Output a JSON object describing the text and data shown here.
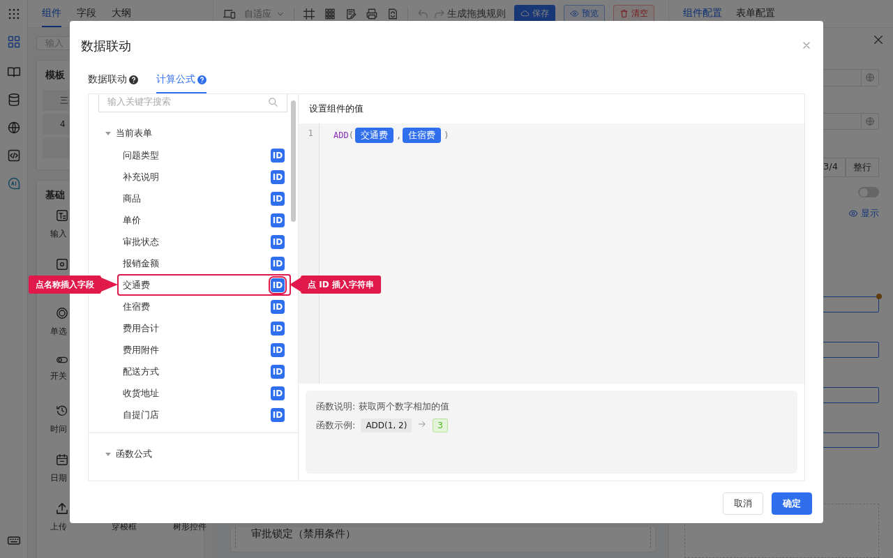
{
  "app": {
    "header_tabs": [
      {
        "label": "组件",
        "selected": true
      },
      {
        "label": "字段",
        "selected": false
      },
      {
        "label": "大纲",
        "selected": false
      }
    ],
    "toolbar": {
      "layout_select": "自适应",
      "generate": "生成拖拽规则",
      "buttons": [
        {
          "label": "保存",
          "kind": "primary"
        },
        {
          "label": "预览",
          "kind": "outline"
        },
        {
          "label": "清空",
          "kind": "danger"
        }
      ]
    },
    "config_tabs": [
      {
        "label": "组件配置",
        "selected": true
      },
      {
        "label": "表单配置",
        "selected": false
      }
    ],
    "left_panel": {
      "search_placeholder": "输入",
      "template": {
        "title": "模板",
        "items": [
          "三",
          "4"
        ]
      },
      "basic": {
        "title": "基础",
        "components": [
          "输入",
          "单选",
          "开关",
          "时间",
          "日期",
          "上传",
          "穿梭框",
          "树形控件"
        ]
      }
    },
    "canvas": {
      "item": "审批锁定（禁用条件）"
    },
    "right_panel": {
      "width_options": [
        "3/4",
        "整行"
      ],
      "switch_on": false,
      "visibility": "显示"
    }
  },
  "dialog": {
    "title": "数据联动",
    "tabs": [
      {
        "label": "数据联动",
        "selected": false
      },
      {
        "label": "计算公式",
        "selected": true
      }
    ],
    "search_placeholder": "输入关键字搜索",
    "tree": [
      {
        "label": "当前表单",
        "expanded": true,
        "children": [
          {
            "label": "问题类型",
            "badge": "ID",
            "highlighted": false
          },
          {
            "label": "补充说明",
            "badge": "ID",
            "highlighted": false
          },
          {
            "label": "商品",
            "badge": "ID",
            "highlighted": false
          },
          {
            "label": "单价",
            "badge": "ID",
            "highlighted": false
          },
          {
            "label": "审批状态",
            "badge": "ID",
            "highlighted": false
          },
          {
            "label": "报销金额",
            "badge": "ID",
            "highlighted": false
          },
          {
            "label": "交通费",
            "badge": "ID",
            "highlighted": true
          },
          {
            "label": "住宿费",
            "badge": "ID",
            "highlighted": false
          },
          {
            "label": "费用合计",
            "badge": "ID",
            "highlighted": false
          },
          {
            "label": "费用附件",
            "badge": "ID",
            "highlighted": false
          },
          {
            "label": "配送方式",
            "badge": "ID",
            "highlighted": false
          },
          {
            "label": "收货地址",
            "badge": "ID",
            "highlighted": false
          },
          {
            "label": "自提门店",
            "badge": "ID",
            "highlighted": false
          }
        ]
      },
      {
        "label": "函数公式",
        "expanded": true
      }
    ],
    "editor_title": "设置组件的值",
    "code_lines": [
      {
        "number": "1",
        "tokens": [
          {
            "kind": "func",
            "text": "ADD"
          },
          {
            "kind": "punct",
            "text": "("
          },
          {
            "kind": "field",
            "text": "交通费"
          },
          {
            "kind": "punct",
            "text": ","
          },
          {
            "kind": "field",
            "text": "住宿费"
          },
          {
            "kind": "punct",
            "text": ")"
          }
        ]
      }
    ],
    "description": "函数说明: 获取两个数字相加的值",
    "example": {
      "label": "函数示例:",
      "code": "ADD(1, 2)",
      "result": "3"
    },
    "buttons": [
      {
        "label": "取消",
        "kind": "default"
      },
      {
        "label": "确定",
        "kind": "primary"
      }
    ],
    "callouts": [
      {
        "text": "点名称插入字段",
        "kind": "right"
      },
      {
        "text": "点 ID 插入字符串",
        "kind": "left"
      }
    ]
  }
}
